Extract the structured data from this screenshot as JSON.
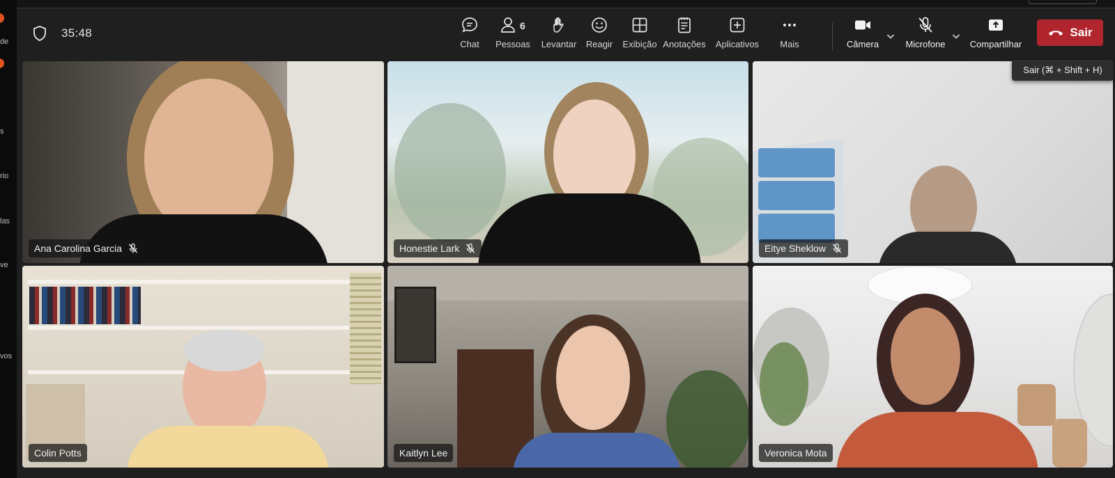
{
  "sidebar": {
    "fragments": [
      "de",
      "s",
      "rio",
      "las",
      "ve",
      "vos"
    ]
  },
  "meeting": {
    "timer": "35:48"
  },
  "toolbar": {
    "chat": {
      "label": "Chat",
      "icon": "chat-bubble-icon"
    },
    "people": {
      "label": "Pessoas",
      "count": "6",
      "icon": "person-icon"
    },
    "raise": {
      "label": "Levantar",
      "icon": "raised-hand-icon"
    },
    "react": {
      "label": "Reagir",
      "icon": "smiley-icon"
    },
    "view": {
      "label": "Exibição",
      "icon": "grid-icon"
    },
    "notes": {
      "label": "Anotações",
      "icon": "notes-icon"
    },
    "apps": {
      "label": "Aplicativos",
      "icon": "plus-square-icon"
    },
    "more": {
      "label": "Mais",
      "icon": "ellipsis-icon"
    },
    "camera": {
      "label": "Câmera",
      "icon": "camera-icon"
    },
    "mic": {
      "label": "Microfone",
      "icon": "mic-muted-icon"
    },
    "share": {
      "label": "Compartilhar",
      "icon": "share-tray-icon"
    },
    "leave": {
      "label": "Sair",
      "tooltip": "Sair (⌘ + Shift + H)",
      "color": "#b1262e"
    }
  },
  "participants": [
    {
      "name": "Ana Carolina Garcia",
      "muted": true
    },
    {
      "name": "Honestie Lark",
      "muted": true
    },
    {
      "name": "Eitye Sheklow",
      "muted": true
    },
    {
      "name": "Colin Potts",
      "muted": false,
      "speaking": true
    },
    {
      "name": "Kaitlyn Lee",
      "muted": false
    },
    {
      "name": "Veronica Mota",
      "muted": false
    }
  ],
  "colors": {
    "background": "#1f1f1f",
    "active_speaker_outline": "#7f7bd6",
    "leave_button": "#b1262e"
  }
}
